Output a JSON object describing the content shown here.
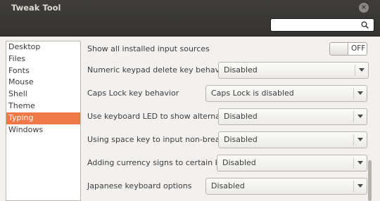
{
  "window": {
    "title": "Tweak Tool",
    "close_glyph": "×"
  },
  "search": {
    "placeholder": "",
    "value": "",
    "icon": "search-icon"
  },
  "sidebar": {
    "items": [
      {
        "label": "Desktop"
      },
      {
        "label": "Files"
      },
      {
        "label": "Fonts"
      },
      {
        "label": "Mouse"
      },
      {
        "label": "Shell"
      },
      {
        "label": "Theme"
      },
      {
        "label": "Typing"
      },
      {
        "label": "Windows"
      }
    ],
    "active": "Typing",
    "accent_color": "#f07746"
  },
  "settings": {
    "show_all_sources": {
      "label": "Show all installed input sources",
      "state": "OFF"
    },
    "rows": [
      {
        "label": "Numeric keypad delete key behavi…",
        "value": "Disabled"
      },
      {
        "label": "Caps Lock key behavior",
        "value": "Caps Lock is disabled"
      },
      {
        "label": "Use keyboard LED to show alterna…",
        "value": "Disabled"
      },
      {
        "label": "Using space key to input non-break…",
        "value": "Disabled"
      },
      {
        "label": "Adding currency signs to certain keys",
        "value": "Disabled"
      },
      {
        "label": "Japanese keyboard options",
        "value": "Disabled"
      }
    ]
  }
}
